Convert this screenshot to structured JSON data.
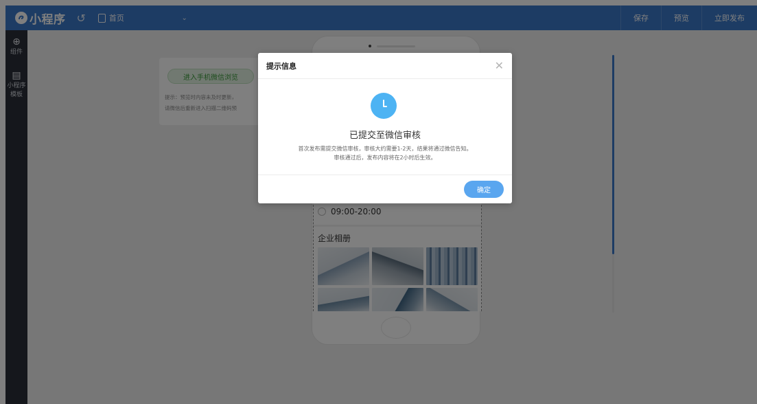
{
  "header": {
    "logo_text": "小程序",
    "page_select_label": "首页",
    "actions": [
      "保存",
      "预览",
      "立即发布"
    ]
  },
  "sidebar": {
    "items": [
      {
        "icon": "plus-circle-icon",
        "label": "组件"
      },
      {
        "icon": "document-icon",
        "label_line1": "小程序",
        "label_line2": "模板"
      }
    ]
  },
  "preview_card": {
    "button_label": "进入手机微信浏览",
    "tip_line1": "提示：预览时内容未及时更新，",
    "tip_line2": "请微信后重新进入扫描二维码预"
  },
  "phone": {
    "hours": "09:00-20:00",
    "album_title": "企业相册"
  },
  "modal": {
    "title": "提示信息",
    "heading": "已提交至微信审核",
    "desc_line1": "首次发布需提交微信审核，审核大约需要1-2天，结果将通过微信告知。",
    "desc_line2": "审核通过后，发布内容将在2小时后生效。",
    "ok_label": "确定"
  },
  "colors": {
    "topbar": "#3a78c8",
    "sidebar": "#2b2f38",
    "clock_icon": "#4db3f3",
    "ok_button": "#5aa6ef"
  }
}
